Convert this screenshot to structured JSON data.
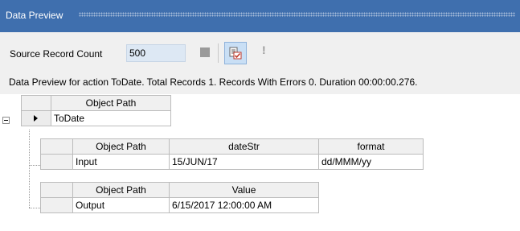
{
  "window": {
    "title": "Data Preview"
  },
  "toolbar": {
    "source_label": "Source Record Count",
    "source_value": "500",
    "stop_icon": "stop-icon",
    "preview_icon": "data-preview-icon",
    "warning_icon": "warning-icon",
    "warning_glyph": "!"
  },
  "summary": {
    "text": "Data Preview for action ToDate. Total Records 1. Records With Errors 0. Duration 00:00:00.276."
  },
  "root_table": {
    "header": "Object Path",
    "row": {
      "value": "ToDate"
    }
  },
  "input_table": {
    "headers": [
      "Object Path",
      "dateStr",
      "format"
    ],
    "row": [
      "Input",
      "15/JUN/17",
      "dd/MMM/yy"
    ]
  },
  "output_table": {
    "headers": [
      "Object Path",
      "Value"
    ],
    "row": [
      "Output",
      "6/15/2017 12:00:00 AM"
    ]
  },
  "colors": {
    "titlebar": "#3f6fae",
    "toolbar": "#f0f0f0",
    "input_bg": "#dde8f4"
  }
}
